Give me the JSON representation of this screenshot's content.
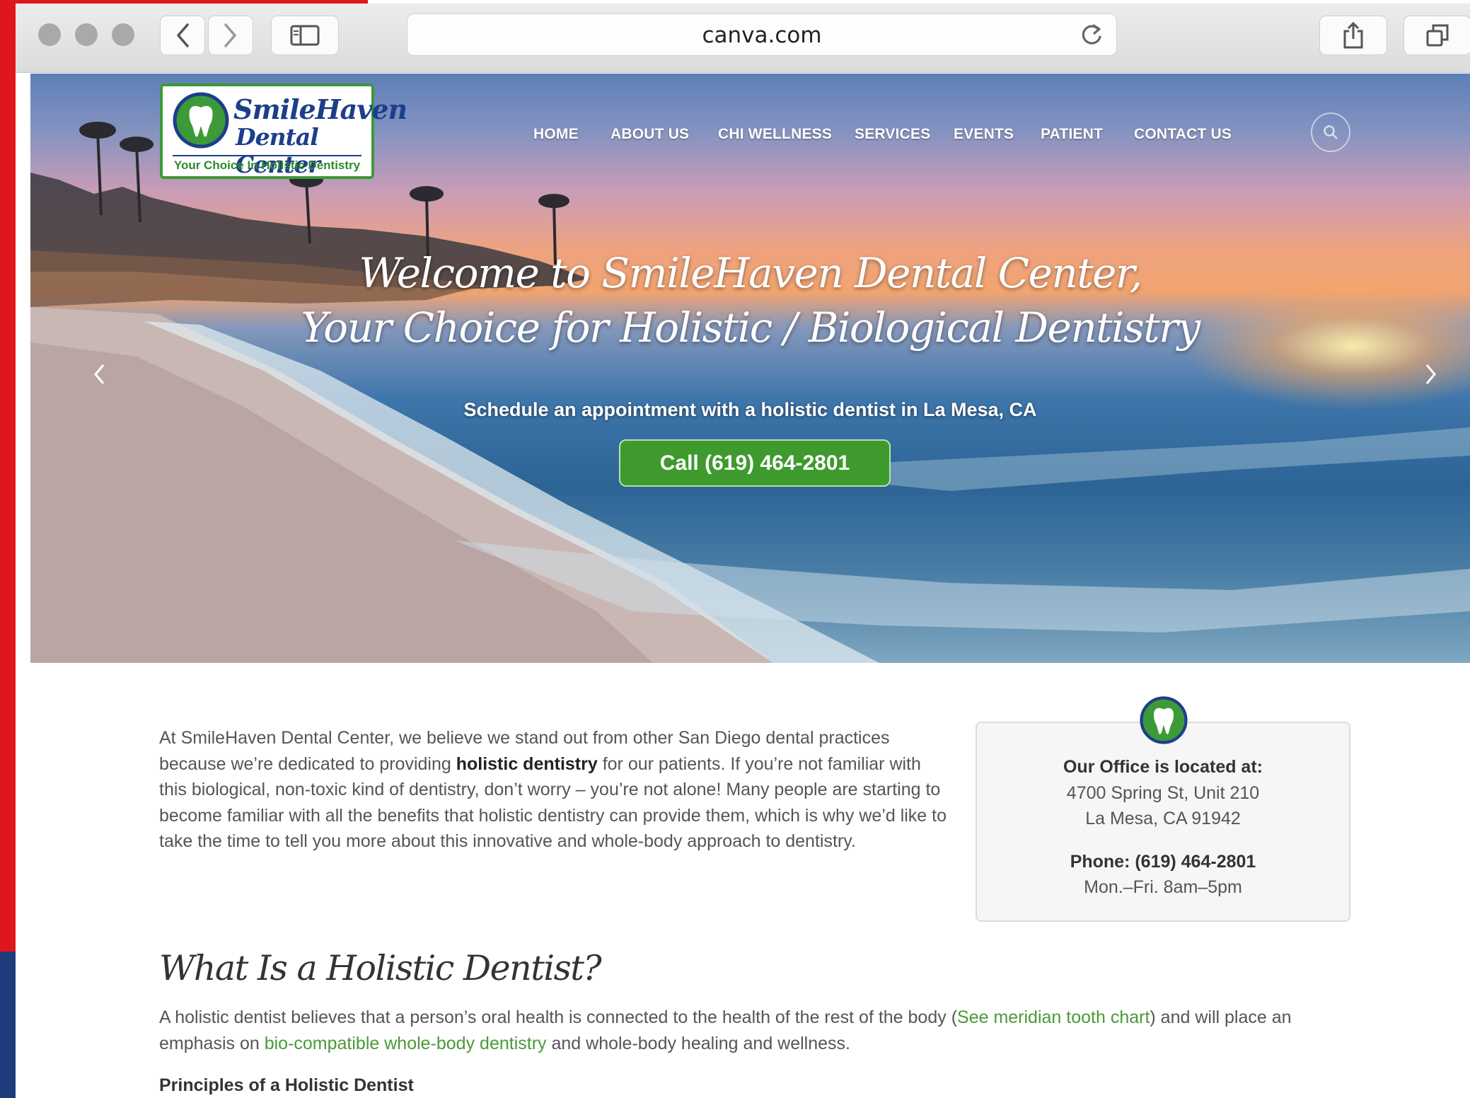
{
  "browser": {
    "url": "canva.com"
  },
  "site": {
    "logo": {
      "name_line1": "SmileHaven",
      "name_line2": "Dental Center",
      "tagline": "Your Choice In Holistic Dentistry"
    },
    "nav": [
      "HOME",
      "ABOUT US",
      "CHI WELLNESS",
      "SERVICES",
      "EVENTS",
      "PATIENT",
      "CONTACT US"
    ],
    "hero": {
      "title_line1": "Welcome to SmileHaven Dental Center,",
      "title_line2": "Your Choice for Holistic / Biological Dentistry",
      "subtitle": "Schedule an appointment with a holistic dentist in La Mesa, CA",
      "cta": "Call (619) 464-2801"
    },
    "intro": {
      "text_before": "At SmileHaven Dental Center, we believe we stand out from other San Diego dental practices because we’re dedicated to providing ",
      "bold": "holistic dentistry",
      "text_after": " for our patients. If you’re not familiar with this biological, non-toxic kind of dentistry, don’t worry – you’re not alone! Many people are starting to become familiar with all the benefits that holistic dentistry can provide them, which is why we’d like to take the time to tell you more about this innovative and whole-body approach to dentistry."
    },
    "office": {
      "heading": "Our Office is located at:",
      "address1": "4700 Spring St, Unit 210",
      "address2": "La Mesa, CA 91942",
      "phone": "Phone: (619) 464-2801",
      "hours": "Mon.–Fri. 8am–5pm"
    },
    "section": {
      "heading": "What Is a Holistic Dentist?",
      "p_start": "A holistic dentist believes that a person’s oral health is connected to the health of the rest of the body (",
      "link1": "See meridian tooth chart",
      "p_mid": ") and will place an emphasis on ",
      "link2": "bio-compatible whole-body dentistry",
      "p_end": " and whole-body healing and wellness.",
      "subheading": "Principles of a Holistic Dentist"
    }
  }
}
